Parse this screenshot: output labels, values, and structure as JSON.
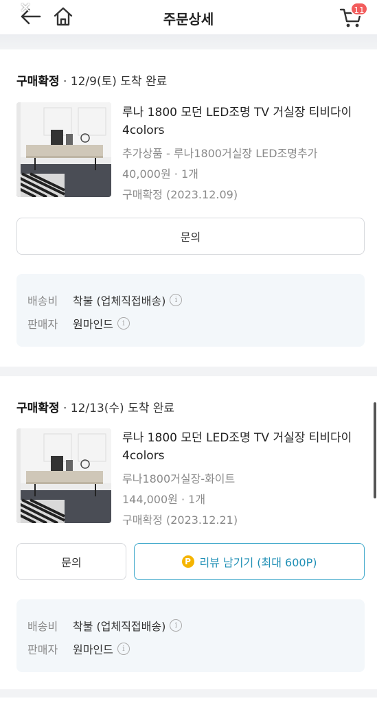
{
  "header": {
    "title": "주문상세",
    "cart_count": "11"
  },
  "orders": [
    {
      "status": "구매확정",
      "delivery": "· 12/9(토) 도착 완료",
      "product_name": "루나 1800 모던 LED조명 TV 거실장 티비다이 4colors",
      "option": "추가상품 - 루나1800거실장 LED조명추가",
      "price_qty": "40,000원 · 1개",
      "confirm": "구매확정 (2023.12.09)",
      "inquiry_label": "문의",
      "shipping_label": "배송비",
      "shipping_value": "착불 (업체직접배송)",
      "seller_label": "판매자",
      "seller_value": "원마인드"
    },
    {
      "status": "구매확정",
      "delivery": "· 12/13(수) 도착 완료",
      "product_name": "루나 1800 모던 LED조명 TV 거실장 티비다이 4colors",
      "option": "루나1800거실장-화이트",
      "price_qty": "144,000원 · 1개",
      "confirm": "구매확정 (2023.12.21)",
      "inquiry_label": "문의",
      "review_label": "리뷰 남기기 (최대 600P)",
      "review_coin": "P",
      "shipping_label": "배송비",
      "shipping_value": "착불 (업체직접배송)",
      "seller_label": "판매자",
      "seller_value": "원마인드"
    }
  ],
  "icons": {
    "close": "close-icon",
    "back": "back-arrow-icon",
    "home": "home-icon",
    "cart": "cart-icon",
    "info": "info-icon"
  },
  "colors": {
    "accent": "#1f8fb5",
    "badge": "#f25c5c",
    "coin": "#f5b400"
  }
}
